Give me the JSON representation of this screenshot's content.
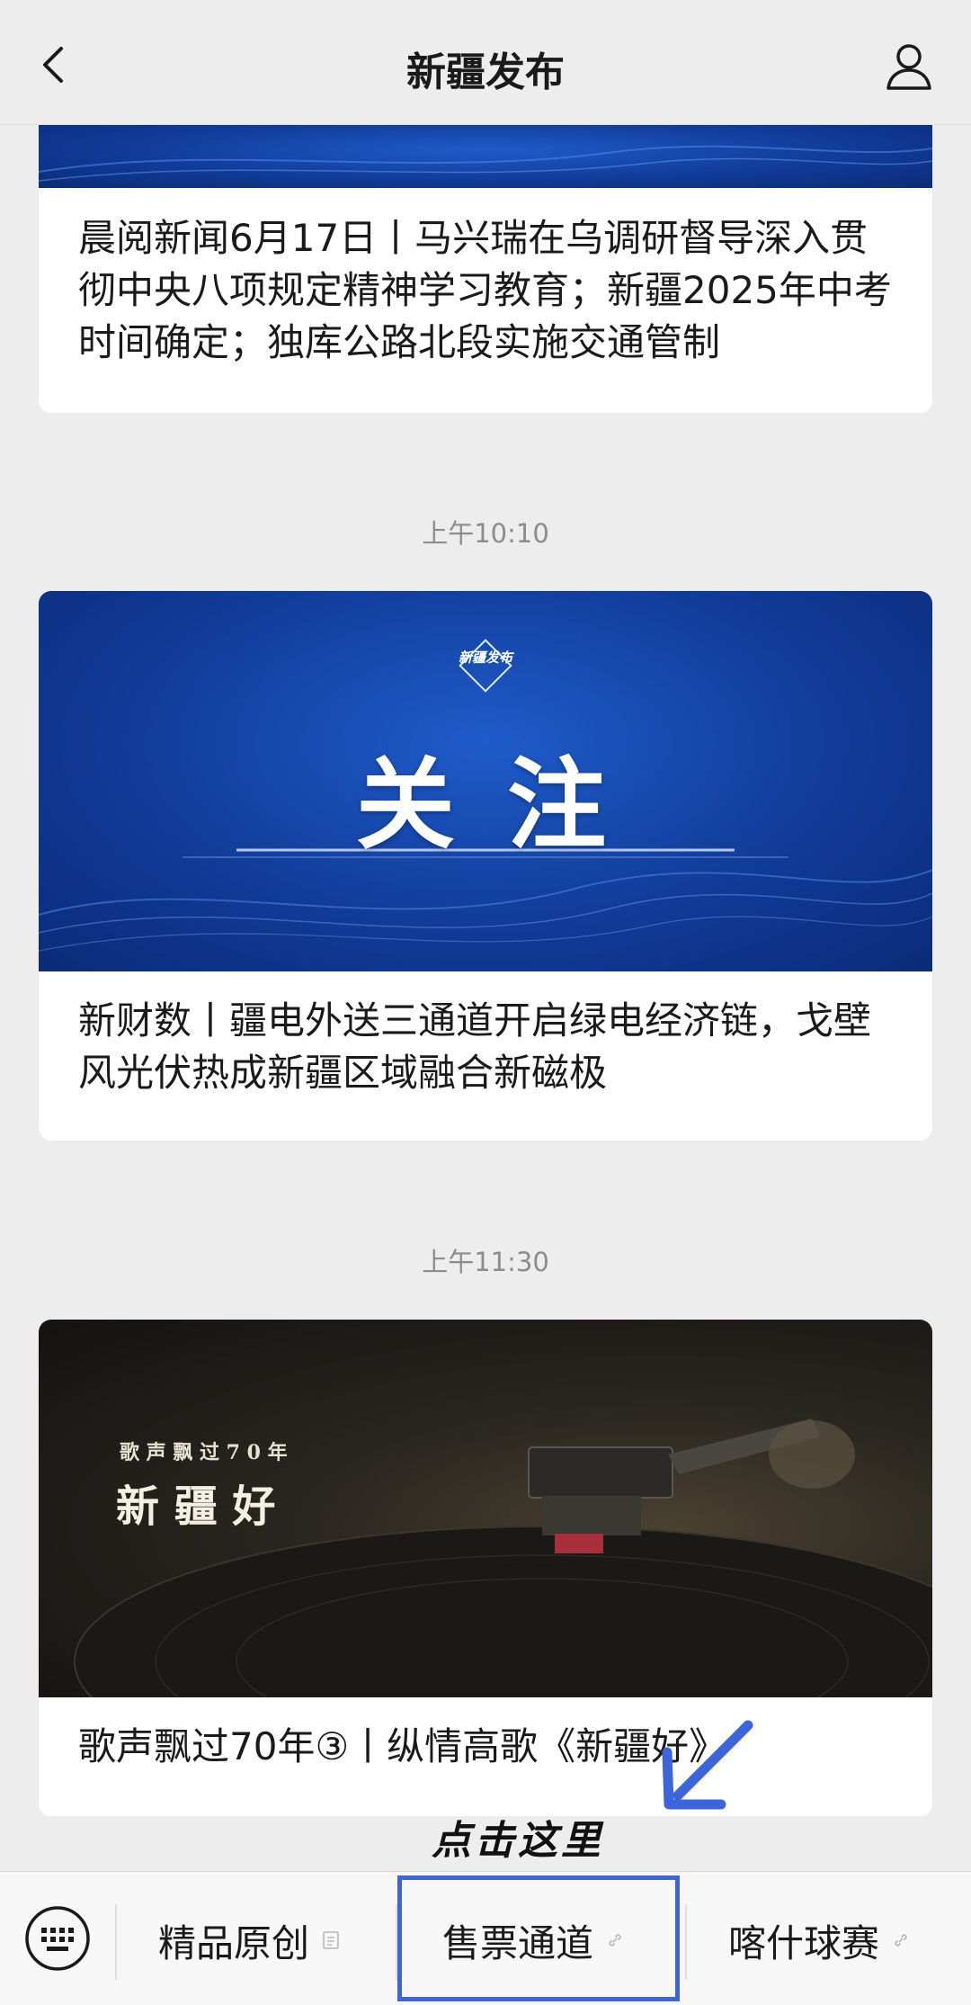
{
  "header": {
    "title": "新疆发布"
  },
  "articles": [
    {
      "title": "晨阅新闻6月17日丨马兴瑞在乌调研督导深入贯彻中央八项规定精神学习教育；新疆2025年中考时间确定；独库公路北段实施交通管制"
    },
    {
      "timestamp": "上午10:10",
      "cover_logo": "新疆发布",
      "cover_text": "关 注",
      "title": "新财数丨疆电外送三通道开启绿电经济链，戈壁风光伏热成新疆区域融合新磁极"
    },
    {
      "timestamp": "上午11:30",
      "cover_line1": "歌 声 飘 过 7 0 年",
      "cover_line2": "新 疆 好",
      "title": "歌声飘过70年③丨纵情高歌《新疆好》"
    }
  ],
  "annotation": {
    "text": "点击这里",
    "color": "#3d64d8"
  },
  "menu": {
    "items": [
      {
        "label": "精品原创",
        "icon": "document-icon"
      },
      {
        "label": "售票通道",
        "icon": "link-icon"
      },
      {
        "label": "喀什球赛",
        "icon": "link-icon"
      }
    ]
  },
  "colors": {
    "accent_blue": "#113c9a",
    "highlight": "#3d64d8"
  }
}
